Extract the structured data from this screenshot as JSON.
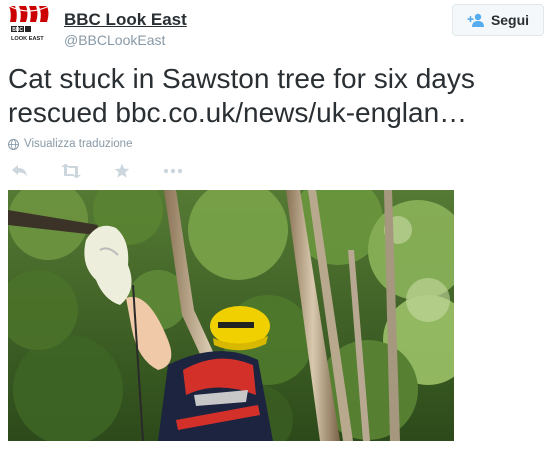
{
  "user": {
    "avatar": {
      "logo_top": "BBC",
      "logo_bottom": "LOOK EAST",
      "colors": {
        "banner": "#cc0000",
        "text": "#222222"
      }
    },
    "name": "BBC Look East",
    "handle": "@BBCLookEast"
  },
  "follow_button": {
    "label": "Segui",
    "icon": "add-user-icon",
    "icon_color": "#55acee"
  },
  "tweet": {
    "text_line1": "Cat stuck in Sawston tree for six days",
    "text_line2": "rescued bbc.co.uk/news/uk-englan…"
  },
  "translate": {
    "label": "Visualizza traduzione",
    "icon": "globe-icon"
  },
  "actions": [
    {
      "icon": "reply-icon"
    },
    {
      "icon": "retweet-icon"
    },
    {
      "icon": "star-icon"
    },
    {
      "icon": "more-icon"
    }
  ],
  "photo": {
    "description_icon": "photo-cat-rescue"
  },
  "colors": {
    "muted": "#8899a6",
    "action": "#ccd6dd",
    "text": "#292f33"
  }
}
